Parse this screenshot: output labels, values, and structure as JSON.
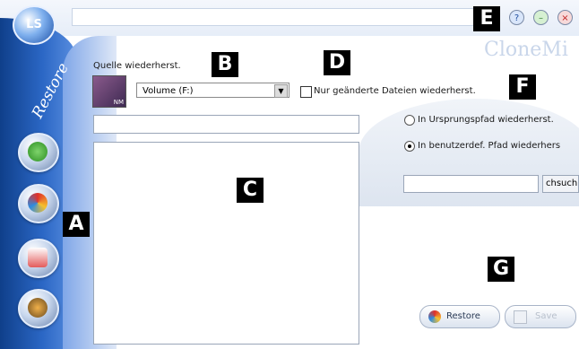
{
  "app": {
    "logo_text": "LS",
    "watermark": "CloneMi"
  },
  "sidebar": {
    "title": "Restore",
    "items": [
      {
        "icon": "download-arrow-icon"
      },
      {
        "icon": "restore-disc-icon"
      },
      {
        "icon": "calendar-schedule-icon"
      },
      {
        "icon": "tools-icon"
      }
    ]
  },
  "window_controls": {
    "help_label": "?",
    "minimize_label": "–",
    "close_label": "×"
  },
  "source": {
    "label": "Quelle wiederherst.",
    "drive_icon_caption": "NM",
    "volume_value": "Volume (F:)"
  },
  "options": {
    "changed_files_only_label": "Nur geänderte Dateien wiederherst.",
    "original_path_label": "In Ursprungspfad wiederherst.",
    "custom_path_label": "In benutzerdef. Pfad wiederhers",
    "browse_label": "chsuch"
  },
  "actions": {
    "restore_label": "Restore",
    "save_label": "Save"
  },
  "annotations": [
    "A",
    "B",
    "C",
    "D",
    "E",
    "F",
    "G"
  ]
}
